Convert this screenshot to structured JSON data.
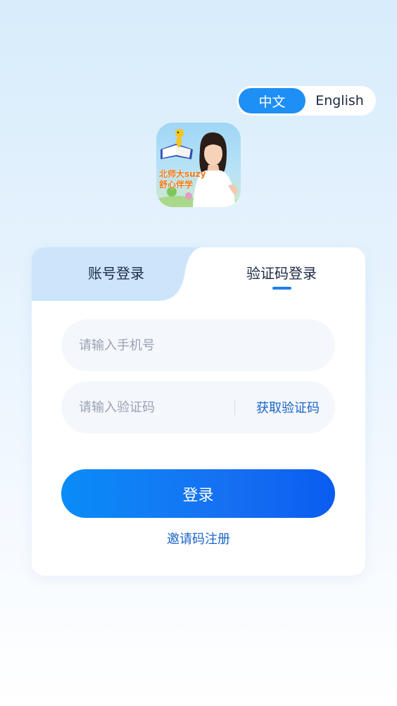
{
  "language": {
    "options": [
      "中文",
      "English"
    ],
    "active": "中文"
  },
  "logo": {
    "text": "北师大suzy\n舒心伴学"
  },
  "tabs": {
    "account": "账号登录",
    "code": "验证码登录",
    "active": "验证码登录"
  },
  "form": {
    "phone_placeholder": "请输入手机号",
    "code_placeholder": "请输入验证码",
    "get_code": "获取验证码",
    "login": "登录",
    "invite_register": "邀请码注册"
  },
  "colors": {
    "accent": "#1e8ff5",
    "link": "#1a64c8",
    "tab_inactive_bg": "#cde5fb"
  }
}
